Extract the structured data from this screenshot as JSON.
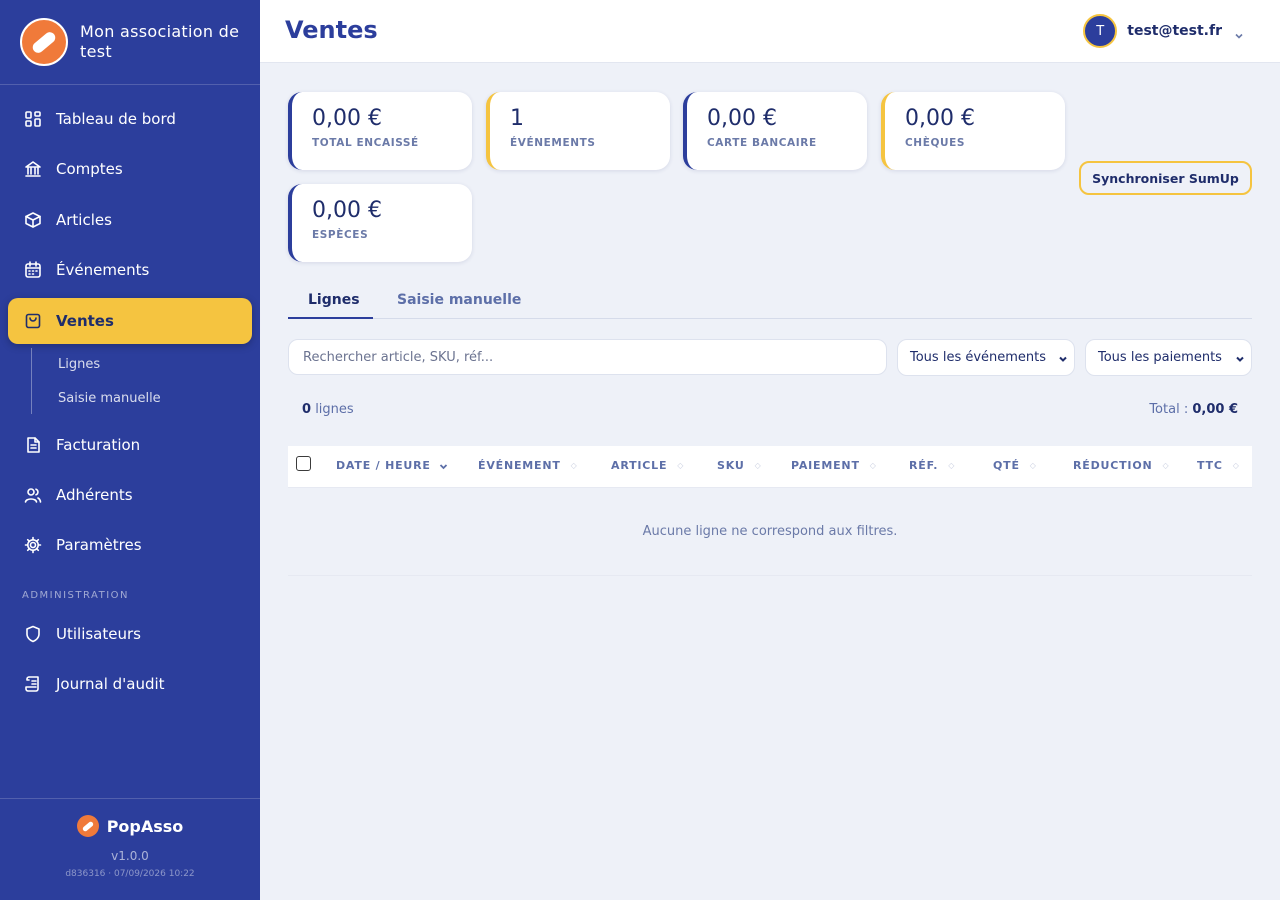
{
  "app": {
    "org_name": "Mon association de test",
    "product_name": "PopAsso",
    "version": "v1.0.0",
    "build": "d836316 · 07/09/2026 10:22"
  },
  "colors": {
    "sidebar": "#2c3e9c",
    "accent": "#f5c440",
    "logo": "#f07a3a",
    "text": "#1f2d6b"
  },
  "sidebar": {
    "items": [
      {
        "label": "Tableau de bord",
        "icon": "dashboard-icon"
      },
      {
        "label": "Comptes",
        "icon": "bank-icon"
      },
      {
        "label": "Articles",
        "icon": "box-icon"
      },
      {
        "label": "Événements",
        "icon": "calendar-icon"
      },
      {
        "label": "Ventes",
        "icon": "shopping-bag-icon",
        "active": true
      },
      {
        "label": "Facturation",
        "icon": "document-icon"
      },
      {
        "label": "Adhérents",
        "icon": "users-icon"
      },
      {
        "label": "Paramètres",
        "icon": "gear-icon"
      }
    ],
    "sub_items": [
      "Lignes",
      "Saisie manuelle"
    ],
    "admin_title": "ADMINISTRATION",
    "admin_items": [
      {
        "label": "Utilisateurs",
        "icon": "shield-icon"
      },
      {
        "label": "Journal d'audit",
        "icon": "scroll-icon"
      }
    ]
  },
  "header": {
    "title": "Ventes",
    "avatar_initial": "T",
    "user_email": "test@test.fr"
  },
  "stats": [
    {
      "value": "0,00 €",
      "label": "TOTAL ENCAISSÉ"
    },
    {
      "value": "1",
      "label": "ÉVÉNEMENTS"
    },
    {
      "value": "0,00 €",
      "label": "CARTE BANCAIRE"
    },
    {
      "value": "0,00 €",
      "label": "CHÈQUES"
    },
    {
      "value": "0,00 €",
      "label": "ESPÈCES"
    }
  ],
  "sync_button": "Synchroniser SumUp",
  "tabs": [
    {
      "label": "Lignes",
      "active": true
    },
    {
      "label": "Saisie manuelle"
    }
  ],
  "filters": {
    "search_placeholder": "Rechercher article, SKU, réf...",
    "event_select": "Tous les événements",
    "payment_select": "Tous les paiements"
  },
  "summary": {
    "count": "0",
    "count_suffix": "lignes",
    "total_label": "Total :",
    "total_value": "0,00 €"
  },
  "table": {
    "columns": [
      "DATE / HEURE",
      "ÉVÉNEMENT",
      "ARTICLE",
      "SKU",
      "PAIEMENT",
      "RÉF.",
      "QTÉ",
      "RÉDUCTION",
      "TTC"
    ],
    "empty_message": "Aucune ligne ne correspond aux filtres."
  }
}
